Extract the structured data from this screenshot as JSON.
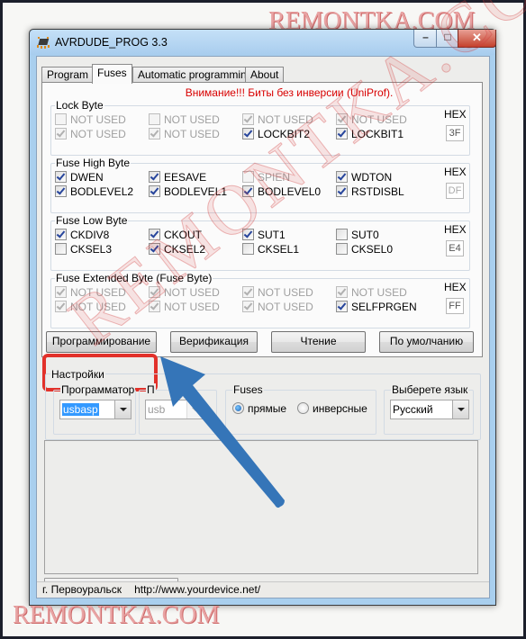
{
  "watermark": {
    "text": "REMONTKA.COM"
  },
  "window": {
    "title": "AVRDUDE_PROG 3.3",
    "icon": "chip-icon",
    "controls": {
      "minimize": "–",
      "maximize": "□",
      "close": "✕"
    }
  },
  "tabs": [
    {
      "label": "Program",
      "active": false
    },
    {
      "label": "Fuses",
      "active": true
    },
    {
      "label": "Automatic programming",
      "active": false
    },
    {
      "label": "About",
      "active": false
    }
  ],
  "fuses": {
    "warning": "Внимание!!! Биты без инверсии (UniProf).",
    "hex_label": "HEX",
    "groups": [
      {
        "title": "Lock Byte",
        "hex": "3F",
        "hex_enabled": true,
        "bits": [
          {
            "label": "NOT USED",
            "checked": false,
            "enabled": false
          },
          {
            "label": "NOT USED",
            "checked": false,
            "enabled": false
          },
          {
            "label": "NOT USED",
            "checked": true,
            "enabled": false
          },
          {
            "label": "NOT USED",
            "checked": true,
            "enabled": false
          },
          {
            "label": "NOT USED",
            "checked": true,
            "enabled": false
          },
          {
            "label": "NOT USED",
            "checked": true,
            "enabled": false
          },
          {
            "label": "LOCKBIT2",
            "checked": true,
            "enabled": true
          },
          {
            "label": "LOCKBIT1",
            "checked": true,
            "enabled": true
          }
        ]
      },
      {
        "title": "Fuse High Byte",
        "hex": "DF",
        "hex_enabled": false,
        "bits": [
          {
            "label": "DWEN",
            "checked": true,
            "enabled": true
          },
          {
            "label": "EESAVE",
            "checked": true,
            "enabled": true
          },
          {
            "label": "SPIEN",
            "checked": false,
            "enabled": false
          },
          {
            "label": "WDTON",
            "checked": true,
            "enabled": true
          },
          {
            "label": "BODLEVEL2",
            "checked": true,
            "enabled": true
          },
          {
            "label": "BODLEVEL1",
            "checked": true,
            "enabled": true
          },
          {
            "label": "BODLEVEL0",
            "checked": true,
            "enabled": true
          },
          {
            "label": "RSTDISBL",
            "checked": true,
            "enabled": true
          }
        ]
      },
      {
        "title": "Fuse Low Byte",
        "hex": "E4",
        "hex_enabled": true,
        "bits": [
          {
            "label": "CKDIV8",
            "checked": true,
            "enabled": true
          },
          {
            "label": "CKOUT",
            "checked": true,
            "enabled": true
          },
          {
            "label": "SUT1",
            "checked": true,
            "enabled": true
          },
          {
            "label": "SUT0",
            "checked": false,
            "enabled": true
          },
          {
            "label": "CKSEL3",
            "checked": false,
            "enabled": true
          },
          {
            "label": "CKSEL2",
            "checked": true,
            "enabled": true
          },
          {
            "label": "CKSEL1",
            "checked": false,
            "enabled": true
          },
          {
            "label": "CKSEL0",
            "checked": false,
            "enabled": true
          }
        ]
      },
      {
        "title": "Fuse Extended Byte (Fuse Byte)",
        "hex": "FF",
        "hex_enabled": true,
        "bits": [
          {
            "label": "NOT USED",
            "checked": true,
            "enabled": false
          },
          {
            "label": "NOT USED",
            "checked": true,
            "enabled": false
          },
          {
            "label": "NOT USED",
            "checked": true,
            "enabled": false
          },
          {
            "label": "NOT USED",
            "checked": true,
            "enabled": false
          },
          {
            "label": "NOT USED",
            "checked": true,
            "enabled": false
          },
          {
            "label": "NOT USED",
            "checked": true,
            "enabled": false
          },
          {
            "label": "NOT USED",
            "checked": true,
            "enabled": false
          },
          {
            "label": "SELFPRGEN",
            "checked": true,
            "enabled": true
          }
        ]
      }
    ],
    "buttons": {
      "program": "Программирование",
      "verify": "Верификация",
      "read": "Чтение",
      "default": "По умолчанию"
    }
  },
  "settings": {
    "title": "Настройки",
    "programmer": {
      "label": "Программатор",
      "value": "usbasp"
    },
    "port": {
      "label": "П",
      "value": "usb"
    },
    "fuses_mode": {
      "label": "Fuses",
      "options": [
        {
          "label": "прямые",
          "selected": true
        },
        {
          "label": "инверсные",
          "selected": false
        }
      ]
    },
    "language": {
      "label": "Выберете язык",
      "value": "Русский"
    }
  },
  "log": {
    "content": ""
  },
  "progress": {
    "value_percent": 0
  },
  "statusbar": {
    "city": "г. Первоуральск",
    "url": "http://www.yourdevice.net/"
  },
  "annotation": {
    "highlight_color": "#e2312a",
    "arrow_color": "#3575b8"
  }
}
